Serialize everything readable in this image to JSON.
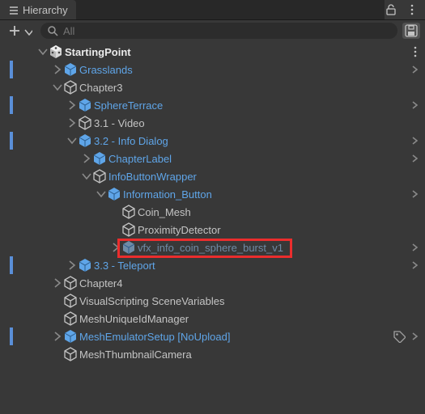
{
  "tab": {
    "title": "Hierarchy"
  },
  "toolbar": {
    "search_placeholder": "All"
  },
  "tree": {
    "root": "StartingPoint",
    "grasslands": "Grasslands",
    "chapter3": "Chapter3",
    "sphereterrace": "SphereTerrace",
    "video": "3.1 - Video",
    "infodialog": "3.2 - Info Dialog",
    "chapterlabel": "ChapterLabel",
    "infobuttonwrapper": "InfoButtonWrapper",
    "informationbutton": "Information_Button",
    "coinmesh": "Coin_Mesh",
    "proximity": "ProximityDetector",
    "vfx": "vfx_info_coin_sphere_burst_v1",
    "teleport": "3.3 - Teleport",
    "chapter4": "Chapter4",
    "visualscripting": "VisualScripting SceneVariables",
    "meshunique": "MeshUniqueIdManager",
    "meshemulator": "MeshEmulatorSetup [NoUpload]",
    "meshthumb": "MeshThumbnailCamera"
  }
}
